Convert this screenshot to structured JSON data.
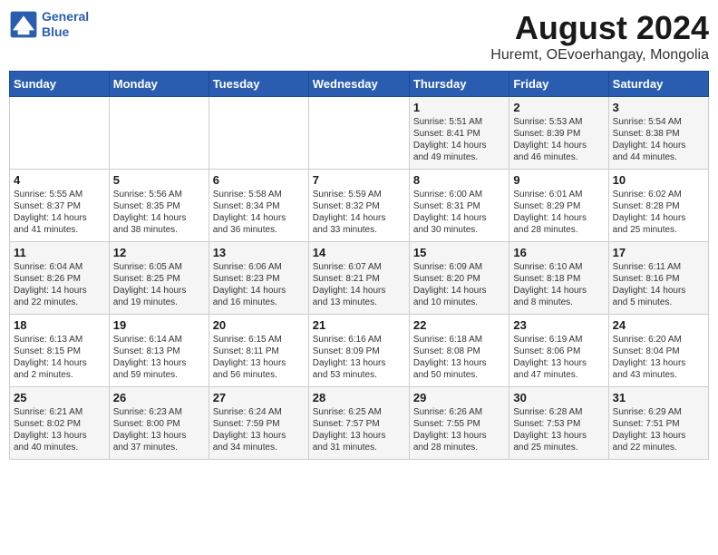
{
  "header": {
    "logo_line1": "General",
    "logo_line2": "Blue",
    "main_title": "August 2024",
    "sub_title": "Huremt, OEvoerhangay, Mongolia"
  },
  "calendar": {
    "weekdays": [
      "Sunday",
      "Monday",
      "Tuesday",
      "Wednesday",
      "Thursday",
      "Friday",
      "Saturday"
    ],
    "weeks": [
      [
        {
          "day": "",
          "info": ""
        },
        {
          "day": "",
          "info": ""
        },
        {
          "day": "",
          "info": ""
        },
        {
          "day": "",
          "info": ""
        },
        {
          "day": "1",
          "info": "Sunrise: 5:51 AM\nSunset: 8:41 PM\nDaylight: 14 hours\nand 49 minutes."
        },
        {
          "day": "2",
          "info": "Sunrise: 5:53 AM\nSunset: 8:39 PM\nDaylight: 14 hours\nand 46 minutes."
        },
        {
          "day": "3",
          "info": "Sunrise: 5:54 AM\nSunset: 8:38 PM\nDaylight: 14 hours\nand 44 minutes."
        }
      ],
      [
        {
          "day": "4",
          "info": "Sunrise: 5:55 AM\nSunset: 8:37 PM\nDaylight: 14 hours\nand 41 minutes."
        },
        {
          "day": "5",
          "info": "Sunrise: 5:56 AM\nSunset: 8:35 PM\nDaylight: 14 hours\nand 38 minutes."
        },
        {
          "day": "6",
          "info": "Sunrise: 5:58 AM\nSunset: 8:34 PM\nDaylight: 14 hours\nand 36 minutes."
        },
        {
          "day": "7",
          "info": "Sunrise: 5:59 AM\nSunset: 8:32 PM\nDaylight: 14 hours\nand 33 minutes."
        },
        {
          "day": "8",
          "info": "Sunrise: 6:00 AM\nSunset: 8:31 PM\nDaylight: 14 hours\nand 30 minutes."
        },
        {
          "day": "9",
          "info": "Sunrise: 6:01 AM\nSunset: 8:29 PM\nDaylight: 14 hours\nand 28 minutes."
        },
        {
          "day": "10",
          "info": "Sunrise: 6:02 AM\nSunset: 8:28 PM\nDaylight: 14 hours\nand 25 minutes."
        }
      ],
      [
        {
          "day": "11",
          "info": "Sunrise: 6:04 AM\nSunset: 8:26 PM\nDaylight: 14 hours\nand 22 minutes."
        },
        {
          "day": "12",
          "info": "Sunrise: 6:05 AM\nSunset: 8:25 PM\nDaylight: 14 hours\nand 19 minutes."
        },
        {
          "day": "13",
          "info": "Sunrise: 6:06 AM\nSunset: 8:23 PM\nDaylight: 14 hours\nand 16 minutes."
        },
        {
          "day": "14",
          "info": "Sunrise: 6:07 AM\nSunset: 8:21 PM\nDaylight: 14 hours\nand 13 minutes."
        },
        {
          "day": "15",
          "info": "Sunrise: 6:09 AM\nSunset: 8:20 PM\nDaylight: 14 hours\nand 10 minutes."
        },
        {
          "day": "16",
          "info": "Sunrise: 6:10 AM\nSunset: 8:18 PM\nDaylight: 14 hours\nand 8 minutes."
        },
        {
          "day": "17",
          "info": "Sunrise: 6:11 AM\nSunset: 8:16 PM\nDaylight: 14 hours\nand 5 minutes."
        }
      ],
      [
        {
          "day": "18",
          "info": "Sunrise: 6:13 AM\nSunset: 8:15 PM\nDaylight: 14 hours\nand 2 minutes."
        },
        {
          "day": "19",
          "info": "Sunrise: 6:14 AM\nSunset: 8:13 PM\nDaylight: 13 hours\nand 59 minutes."
        },
        {
          "day": "20",
          "info": "Sunrise: 6:15 AM\nSunset: 8:11 PM\nDaylight: 13 hours\nand 56 minutes."
        },
        {
          "day": "21",
          "info": "Sunrise: 6:16 AM\nSunset: 8:09 PM\nDaylight: 13 hours\nand 53 minutes."
        },
        {
          "day": "22",
          "info": "Sunrise: 6:18 AM\nSunset: 8:08 PM\nDaylight: 13 hours\nand 50 minutes."
        },
        {
          "day": "23",
          "info": "Sunrise: 6:19 AM\nSunset: 8:06 PM\nDaylight: 13 hours\nand 47 minutes."
        },
        {
          "day": "24",
          "info": "Sunrise: 6:20 AM\nSunset: 8:04 PM\nDaylight: 13 hours\nand 43 minutes."
        }
      ],
      [
        {
          "day": "25",
          "info": "Sunrise: 6:21 AM\nSunset: 8:02 PM\nDaylight: 13 hours\nand 40 minutes."
        },
        {
          "day": "26",
          "info": "Sunrise: 6:23 AM\nSunset: 8:00 PM\nDaylight: 13 hours\nand 37 minutes."
        },
        {
          "day": "27",
          "info": "Sunrise: 6:24 AM\nSunset: 7:59 PM\nDaylight: 13 hours\nand 34 minutes."
        },
        {
          "day": "28",
          "info": "Sunrise: 6:25 AM\nSunset: 7:57 PM\nDaylight: 13 hours\nand 31 minutes."
        },
        {
          "day": "29",
          "info": "Sunrise: 6:26 AM\nSunset: 7:55 PM\nDaylight: 13 hours\nand 28 minutes."
        },
        {
          "day": "30",
          "info": "Sunrise: 6:28 AM\nSunset: 7:53 PM\nDaylight: 13 hours\nand 25 minutes."
        },
        {
          "day": "31",
          "info": "Sunrise: 6:29 AM\nSunset: 7:51 PM\nDaylight: 13 hours\nand 22 minutes."
        }
      ]
    ]
  }
}
